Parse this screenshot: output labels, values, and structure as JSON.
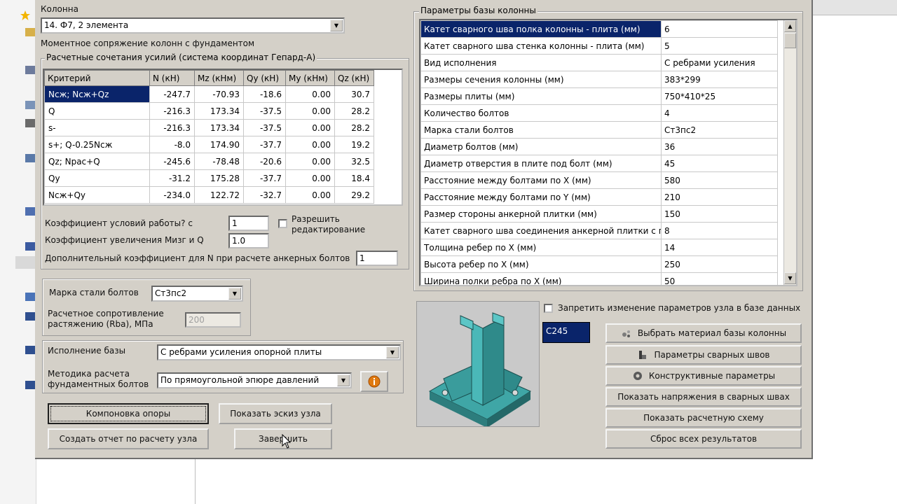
{
  "left_panel": {
    "column_label": "Колонна",
    "column_value": "14. Ф7, 2 элемента",
    "moment_label": "Моментное сопряжение колонн с фундаментом",
    "forces_group_title": "Расчетные сочетания усилий (система координат Гепард-А)",
    "forces_table": {
      "headers": [
        "Критерий",
        "N (кН)",
        "Mz (кНм)",
        "Qy (кН)",
        "My (кНм)",
        "Qz (кН)"
      ],
      "rows": [
        [
          "Nсж; Nсж+Qz",
          "-247.7",
          "-70.93",
          "-18.6",
          "0.00",
          "30.7"
        ],
        [
          "Q",
          "-216.3",
          "173.34",
          "-37.5",
          "0.00",
          "28.2"
        ],
        [
          "s-",
          "-216.3",
          "173.34",
          "-37.5",
          "0.00",
          "28.2"
        ],
        [
          "s+; Q-0.25Nсж",
          "-8.0",
          "174.90",
          "-37.7",
          "0.00",
          "19.2"
        ],
        [
          "Qz; Nрас+Q",
          "-245.6",
          "-78.48",
          "-20.6",
          "0.00",
          "32.5"
        ],
        [
          "Qy",
          "-31.2",
          "175.28",
          "-37.7",
          "0.00",
          "18.4"
        ],
        [
          "Nсж+Qy",
          "-234.0",
          "122.72",
          "-32.7",
          "0.00",
          "29.2"
        ]
      ]
    },
    "work_coef_label": "Коэффициент условий работы? с",
    "work_coef_value": "1",
    "allow_edit_label": "Разрешить редактирование",
    "increase_coef_label": "Коэффициент увеличения  Mизг и Q",
    "increase_coef_value": "1.0",
    "extra_coef_label": "Дополнительный коэффициент для N при расчете анкерных болтов",
    "extra_coef_value": "1",
    "steel_label": "Марка стали болтов",
    "steel_value": "Ст3пс2",
    "resistance_label": "Расчетное сопротивление растяжению (Rba), МПа",
    "resistance_value": "200",
    "base_type_label": "Исполнение базы",
    "base_type_value": "С ребрами усиления опорной плиты",
    "method_label": "Методика расчета фундаментных болтов",
    "method_value": "По прямоугольной эпюре давлений",
    "buttons": {
      "layout": "Компоновка опоры",
      "sketch": "Показать эскиз узла",
      "report": "Создать отчет по расчету узла",
      "finish": "Завершить"
    }
  },
  "right_panel": {
    "params_group_title": "Параметры базы колонны",
    "params": [
      [
        "Катет сварного шва полка колонны - плита (мм)",
        "6"
      ],
      [
        "Катет сварного шва стенка колонны - плита (мм)",
        "5"
      ],
      [
        "Вид исполнения",
        "С ребрами усиления"
      ],
      [
        "Размеры сечения колонны (мм)",
        "383*299"
      ],
      [
        "Размеры плиты (мм)",
        "750*410*25"
      ],
      [
        "Количество болтов",
        "4"
      ],
      [
        "Марка стали болтов",
        "Ст3пс2"
      ],
      [
        "Диаметр болтов (мм)",
        "36"
      ],
      [
        "Диаметр отверстия в плите под болт (мм)",
        "45"
      ],
      [
        "Расстояние между болтами по X (мм)",
        "580"
      ],
      [
        "Расстояние между болтами по Y (мм)",
        "210"
      ],
      [
        "Размер стороны анкерной плитки (мм)",
        "150"
      ],
      [
        "Катет сварного шва соединения анкерной плитки с п",
        "8"
      ],
      [
        "Толщина ребер по X (мм)",
        "14"
      ],
      [
        "Высота ребер по X (мм)",
        "250"
      ],
      [
        "Ширина полки ребра по X (мм)",
        "50"
      ]
    ],
    "lock_label": "Запретить изменение параметров узла в базе данных",
    "material_value": "С245",
    "buttons": {
      "material": "Выбрать материал базы колонны",
      "welds": "Параметры сварных швов",
      "constructive": "Конструктивные параметры",
      "stress": "Показать напряжения в сварных швах",
      "scheme": "Показать расчетную схему",
      "reset": "Сброс всех результатов"
    }
  },
  "colors": {
    "dialog_bg": "#d4d0c8",
    "selection": "#0a246a",
    "model_bg": "#c8c8c8",
    "model_steel": "#3fa6a6"
  },
  "icons": [
    "material-icon",
    "weld-icon",
    "gear-icon",
    "info-icon",
    "column-base-model-icon"
  ]
}
